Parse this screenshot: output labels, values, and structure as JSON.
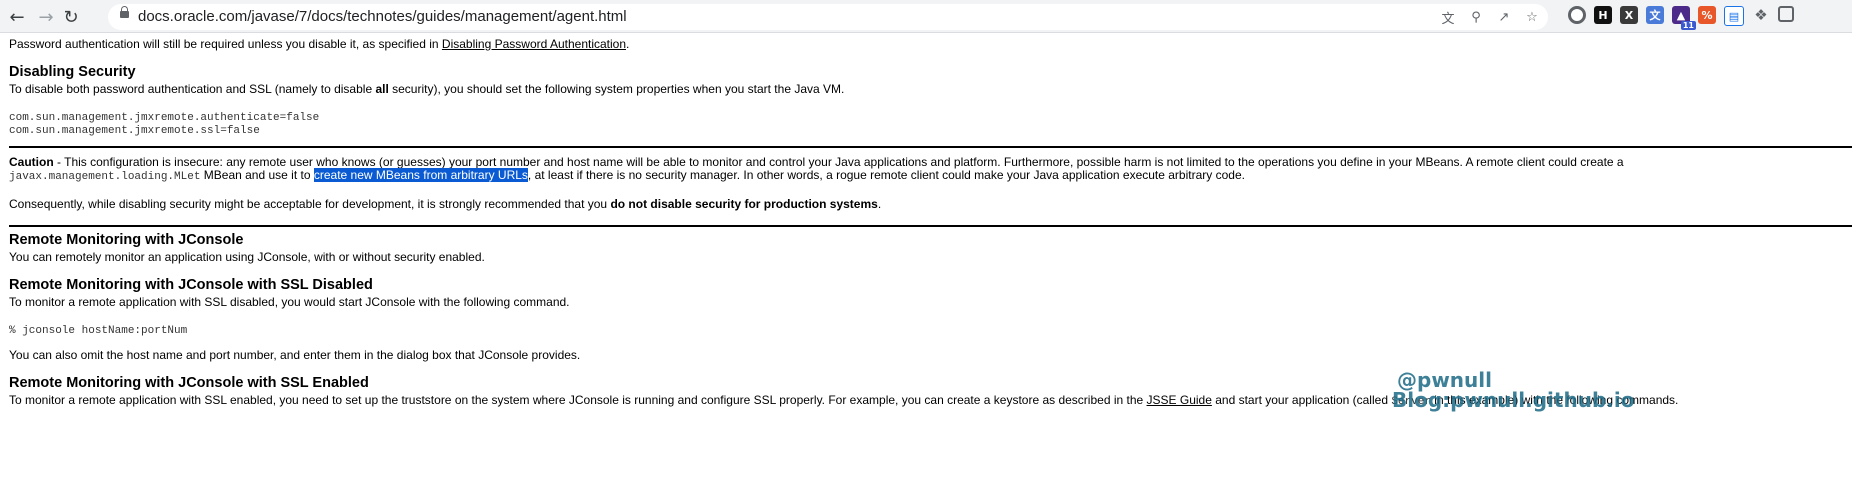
{
  "browser": {
    "url": "docs.oracle.com/javase/7/docs/technotes/guides/management/agent.html",
    "extension_badge": "11"
  },
  "page": {
    "intro": {
      "before": "Password authentication will still be required unless you disable it, as specified in ",
      "link": "Disabling Password Authentication",
      "after": "."
    },
    "disabling_security": {
      "heading": "Disabling Security",
      "p_before": "To disable both password authentication and SSL (namely to disable ",
      "p_bold": "all",
      "p_after": " security), you should set the following system properties when you start the Java VM.",
      "code_line1": "com.sun.management.jmxremote.authenticate=false",
      "code_line2": "com.sun.management.jmxremote.ssl=false"
    },
    "caution": {
      "label": "Caution",
      "text1": " - This configuration is insecure: any remote user who knows (or guesses) your port number and host name will be able to monitor and control your Java applications and platform. Furthermore, possible harm is not limited to the operations you define in your MBeans. A remote client could create a",
      "code": "javax.management.loading.MLet",
      "text2": " MBean and use it to ",
      "highlight": "create new MBeans from arbitrary URLs",
      "text3": ", at least if there is no security manager. In other words, a rogue remote client could make your Java application execute arbitrary code.",
      "consequently_before": "Consequently, while disabling security might be acceptable for development, it is strongly recommended that you ",
      "consequently_bold": "do not disable security for production systems",
      "consequently_after": "."
    },
    "jconsole": {
      "heading": "Remote Monitoring with JConsole",
      "text": "You can remotely monitor an application using JConsole, with or without security enabled."
    },
    "ssl_disabled": {
      "heading": "Remote Monitoring with JConsole with SSL Disabled",
      "text": "To monitor a remote application with SSL disabled, you would start JConsole with the following command.",
      "code": "% jconsole hostName:portNum",
      "text2": "You can also omit the host name and port number, and enter them in the dialog box that JConsole provides."
    },
    "ssl_enabled": {
      "heading": "Remote Monitoring with JConsole with SSL Enabled",
      "text_before": "To monitor a remote application with SSL enabled, you need to set up the truststore on the system where JConsole is running and configure SSL properly. For example, you can create a keystore as described in the ",
      "link": "JSSE Guide",
      "text_mid": " and start your application (called ",
      "code": "Server",
      "text_after": " in this example) with the following commands."
    }
  },
  "watermark": {
    "line1": "@pwnull",
    "line2": "Blog:pwnull.github.io"
  }
}
